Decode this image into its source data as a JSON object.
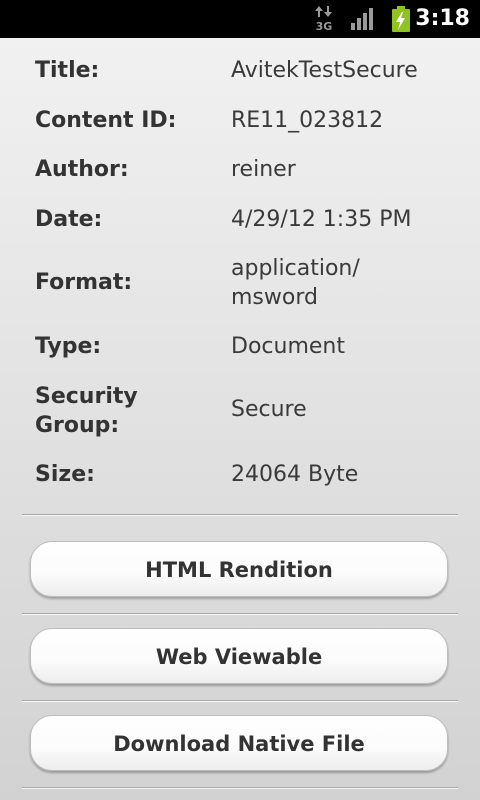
{
  "status_bar": {
    "network_type": "3G",
    "time": "3:18",
    "icons": [
      "data-transfer-icon",
      "signal-strength-icon",
      "battery-charging-icon"
    ]
  },
  "details": [
    {
      "label": "Title:",
      "value": "AvitekTestSecure"
    },
    {
      "label": "Content ID:",
      "value": "RE11_023812"
    },
    {
      "label": "Author:",
      "value": "reiner"
    },
    {
      "label": "Date:",
      "value": "4/29/12 1:35 PM"
    },
    {
      "label": "Format:",
      "value": "application/\nmsword"
    },
    {
      "label": "Type:",
      "value": "Document"
    },
    {
      "label": "Security\nGroup:",
      "value": "Secure"
    },
    {
      "label": "Size:",
      "value": "24064 Byte"
    }
  ],
  "actions": {
    "html_rendition": "HTML Rendition",
    "web_viewable": "Web Viewable",
    "download_native": "Download Native File"
  },
  "colors": {
    "status_bar_bg": "#000000",
    "battery_charge": "#8fc31f"
  }
}
